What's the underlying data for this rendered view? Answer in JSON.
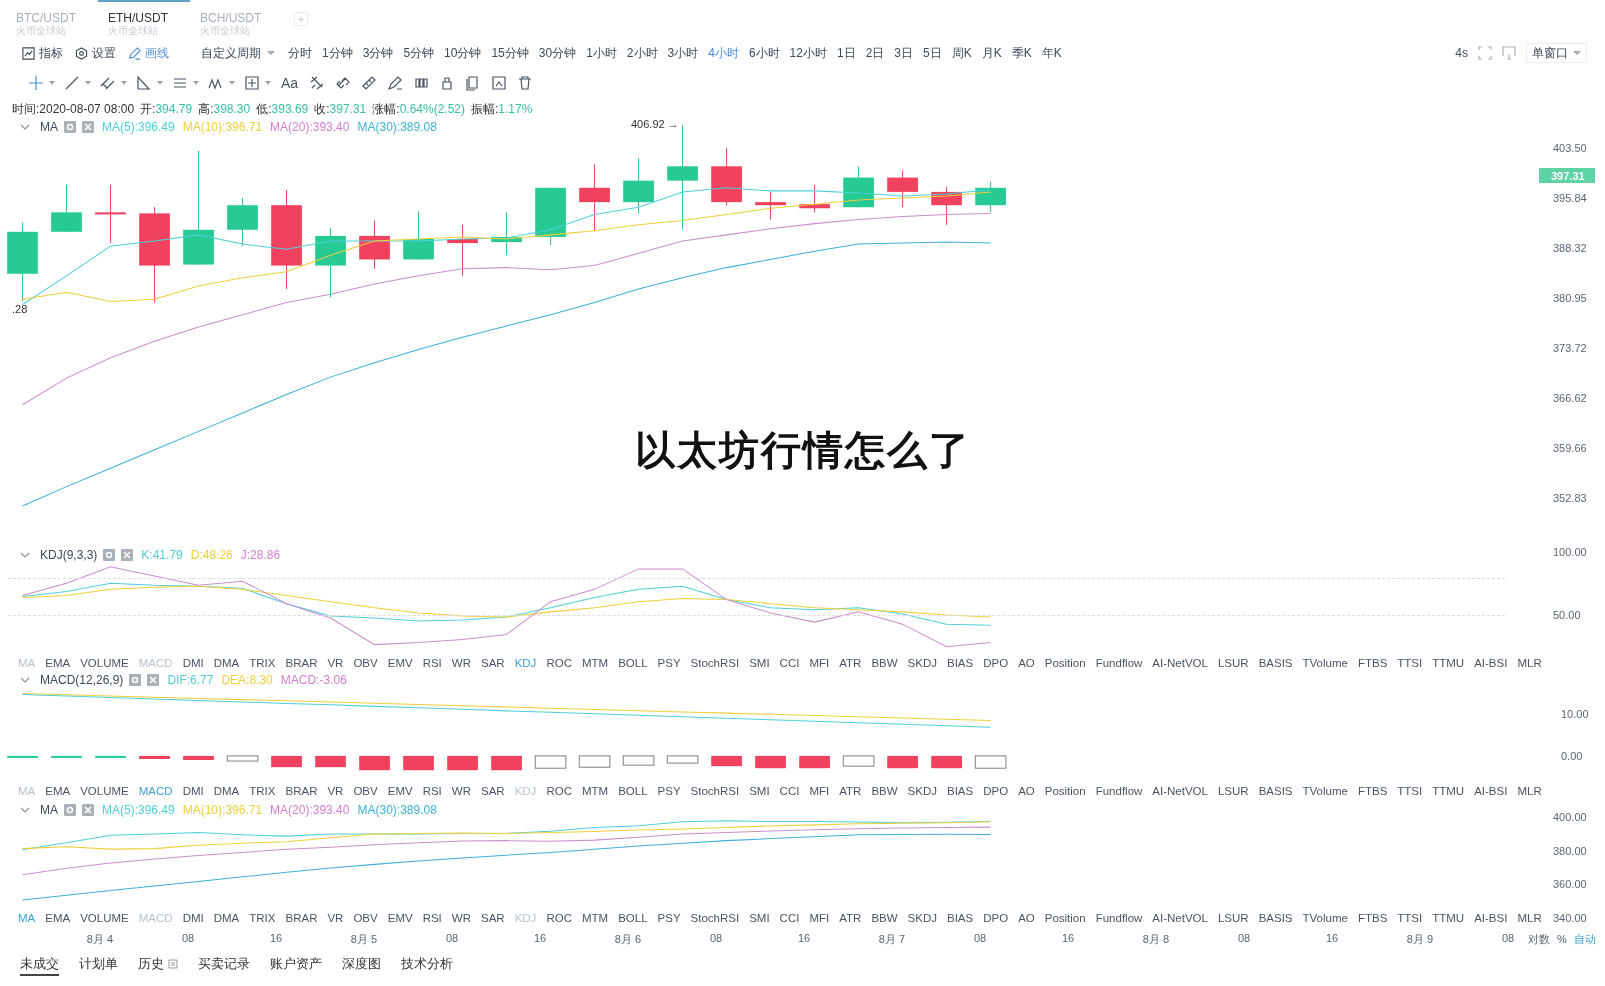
{
  "symbol_tabs": [
    {
      "pair": "BTC/USDT",
      "exchange": "火币全球站",
      "selected": false
    },
    {
      "pair": "ETH/USDT",
      "exchange": "火币全球站",
      "selected": true
    },
    {
      "pair": "BCH/USDT",
      "exchange": "火币全球站",
      "selected": false
    }
  ],
  "add_tab": "+",
  "tools": [
    {
      "label": "指标",
      "selected": false
    },
    {
      "label": "设置",
      "selected": false
    },
    {
      "label": "画线",
      "selected": true
    }
  ],
  "custom_period": "自定义周期",
  "periods": [
    {
      "label": "分时",
      "selected": false
    },
    {
      "label": "1分钟",
      "selected": false
    },
    {
      "label": "3分钟",
      "selected": false
    },
    {
      "label": "5分钟",
      "selected": false
    },
    {
      "label": "10分钟",
      "selected": false
    },
    {
      "label": "15分钟",
      "selected": false
    },
    {
      "label": "30分钟",
      "selected": false
    },
    {
      "label": "1小时",
      "selected": false
    },
    {
      "label": "2小时",
      "selected": false
    },
    {
      "label": "3小时",
      "selected": false
    },
    {
      "label": "4小时",
      "selected": true
    },
    {
      "label": "6小时",
      "selected": false
    },
    {
      "label": "12小时",
      "selected": false
    },
    {
      "label": "1日",
      "selected": false
    },
    {
      "label": "2日",
      "selected": false
    },
    {
      "label": "3日",
      "selected": false
    },
    {
      "label": "5日",
      "selected": false
    },
    {
      "label": "周K",
      "selected": false
    },
    {
      "label": "月K",
      "selected": false
    },
    {
      "label": "季K",
      "selected": false
    },
    {
      "label": "年K",
      "selected": false
    }
  ],
  "refresh": "4s",
  "window_mode": "单窗口",
  "text_tool": "Aa",
  "ohlc": [
    {
      "label": "时间:",
      "value": "2020-08-07 08:00"
    },
    {
      "label": "开:",
      "value": "394.79"
    },
    {
      "label": "高:",
      "value": "398.30"
    },
    {
      "label": "低:",
      "value": "393.69"
    },
    {
      "label": "收:",
      "value": "397.31"
    },
    {
      "label": "涨幅:",
      "value": "0.64%(2.52)"
    },
    {
      "label": "振幅:",
      "value": "1.17%"
    }
  ],
  "main_pane": {
    "name": "MA",
    "values": [
      {
        "text": "MA(5):396.49",
        "color": "#4fd0d8"
      },
      {
        "text": "MA(10):396.71",
        "color": "#efcf3a"
      },
      {
        "text": "MA(20):393.40",
        "color": "#d57fd0"
      },
      {
        "text": "MA(30):389.08",
        "color": "#3fb0d6"
      }
    ],
    "ticks": [
      "403.50",
      "395.84",
      "388.32",
      "380.95",
      "373.72",
      "366.62",
      "359.66",
      "352.83"
    ],
    "last_price": "397.31",
    "high_marker": "406.92 →",
    "low_marker": ".28",
    "caption": "以太坊行情怎么了"
  },
  "kdj_pane": {
    "name": "KDJ(9,3,3)",
    "values": [
      {
        "text": "K:41.79",
        "color": "#4fd0d8"
      },
      {
        "text": "D:48.26",
        "color": "#efcf3a"
      },
      {
        "text": "J:28.86",
        "color": "#d57fd0"
      }
    ],
    "ticks": [
      "100.00",
      "50.00"
    ]
  },
  "indicator_bars": [
    [
      {
        "label": "MA",
        "selected": false,
        "disabled": true
      },
      {
        "label": "EMA",
        "selected": false,
        "disabled": false
      },
      {
        "label": "VOLUME",
        "selected": false,
        "disabled": false
      },
      {
        "label": "MACD",
        "selected": false,
        "disabled": true
      },
      {
        "label": "DMI",
        "selected": false,
        "disabled": false
      },
      {
        "label": "DMA",
        "selected": false,
        "disabled": false
      },
      {
        "label": "TRIX",
        "selected": false,
        "disabled": false
      },
      {
        "label": "BRAR",
        "selected": false,
        "disabled": false
      },
      {
        "label": "VR",
        "selected": false,
        "disabled": false
      },
      {
        "label": "OBV",
        "selected": false,
        "disabled": false
      },
      {
        "label": "EMV",
        "selected": false,
        "disabled": false
      },
      {
        "label": "RSI",
        "selected": false,
        "disabled": false
      },
      {
        "label": "WR",
        "selected": false,
        "disabled": false
      },
      {
        "label": "SAR",
        "selected": false,
        "disabled": false
      },
      {
        "label": "KDJ",
        "selected": true,
        "disabled": false
      },
      {
        "label": "ROC",
        "selected": false,
        "disabled": false
      },
      {
        "label": "MTM",
        "selected": false,
        "disabled": false
      },
      {
        "label": "BOLL",
        "selected": false,
        "disabled": false
      },
      {
        "label": "PSY",
        "selected": false,
        "disabled": false
      },
      {
        "label": "StochRSI",
        "selected": false,
        "disabled": false
      },
      {
        "label": "SMI",
        "selected": false,
        "disabled": false
      },
      {
        "label": "CCI",
        "selected": false,
        "disabled": false
      },
      {
        "label": "MFI",
        "selected": false,
        "disabled": false
      },
      {
        "label": "ATR",
        "selected": false,
        "disabled": false
      },
      {
        "label": "BBW",
        "selected": false,
        "disabled": false
      },
      {
        "label": "SKDJ",
        "selected": false,
        "disabled": false
      },
      {
        "label": "BIAS",
        "selected": false,
        "disabled": false
      },
      {
        "label": "DPO",
        "selected": false,
        "disabled": false
      },
      {
        "label": "AO",
        "selected": false,
        "disabled": false
      },
      {
        "label": "Position",
        "selected": false,
        "disabled": false
      },
      {
        "label": "Fundflow",
        "selected": false,
        "disabled": false
      },
      {
        "label": "AI-NetVOL",
        "selected": false,
        "disabled": false
      },
      {
        "label": "LSUR",
        "selected": false,
        "disabled": false
      },
      {
        "label": "BASIS",
        "selected": false,
        "disabled": false
      },
      {
        "label": "TVolume",
        "selected": false,
        "disabled": false
      },
      {
        "label": "FTBS",
        "selected": false,
        "disabled": false
      },
      {
        "label": "TTSI",
        "selected": false,
        "disabled": false
      },
      {
        "label": "TTMU",
        "selected": false,
        "disabled": false
      },
      {
        "label": "AI-BSI",
        "selected": false,
        "disabled": false
      },
      {
        "label": "MLR",
        "selected": false,
        "disabled": false
      }
    ],
    [
      {
        "label": "MA",
        "selected": false,
        "disabled": true
      },
      {
        "label": "EMA",
        "selected": false,
        "disabled": false
      },
      {
        "label": "VOLUME",
        "selected": false,
        "disabled": false
      },
      {
        "label": "MACD",
        "selected": true,
        "disabled": false
      },
      {
        "label": "DMI",
        "selected": false,
        "disabled": false
      },
      {
        "label": "DMA",
        "selected": false,
        "disabled": false
      },
      {
        "label": "TRIX",
        "selected": false,
        "disabled": false
      },
      {
        "label": "BRAR",
        "selected": false,
        "disabled": false
      },
      {
        "label": "VR",
        "selected": false,
        "disabled": false
      },
      {
        "label": "OBV",
        "selected": false,
        "disabled": false
      },
      {
        "label": "EMV",
        "selected": false,
        "disabled": false
      },
      {
        "label": "RSI",
        "selected": false,
        "disabled": false
      },
      {
        "label": "WR",
        "selected": false,
        "disabled": false
      },
      {
        "label": "SAR",
        "selected": false,
        "disabled": false
      },
      {
        "label": "KDJ",
        "selected": false,
        "disabled": true
      },
      {
        "label": "ROC",
        "selected": false,
        "disabled": false
      },
      {
        "label": "MTM",
        "selected": false,
        "disabled": false
      },
      {
        "label": "BOLL",
        "selected": false,
        "disabled": false
      },
      {
        "label": "PSY",
        "selected": false,
        "disabled": false
      },
      {
        "label": "StochRSI",
        "selected": false,
        "disabled": false
      },
      {
        "label": "SMI",
        "selected": false,
        "disabled": false
      },
      {
        "label": "CCI",
        "selected": false,
        "disabled": false
      },
      {
        "label": "MFI",
        "selected": false,
        "disabled": false
      },
      {
        "label": "ATR",
        "selected": false,
        "disabled": false
      },
      {
        "label": "BBW",
        "selected": false,
        "disabled": false
      },
      {
        "label": "SKDJ",
        "selected": false,
        "disabled": false
      },
      {
        "label": "BIAS",
        "selected": false,
        "disabled": false
      },
      {
        "label": "DPO",
        "selected": false,
        "disabled": false
      },
      {
        "label": "AO",
        "selected": false,
        "disabled": false
      },
      {
        "label": "Position",
        "selected": false,
        "disabled": false
      },
      {
        "label": "Fundflow",
        "selected": false,
        "disabled": false
      },
      {
        "label": "AI-NetVOL",
        "selected": false,
        "disabled": false
      },
      {
        "label": "LSUR",
        "selected": false,
        "disabled": false
      },
      {
        "label": "BASIS",
        "selected": false,
        "disabled": false
      },
      {
        "label": "TVolume",
        "selected": false,
        "disabled": false
      },
      {
        "label": "FTBS",
        "selected": false,
        "disabled": false
      },
      {
        "label": "TTSI",
        "selected": false,
        "disabled": false
      },
      {
        "label": "TTMU",
        "selected": false,
        "disabled": false
      },
      {
        "label": "AI-BSI",
        "selected": false,
        "disabled": false
      },
      {
        "label": "MLR",
        "selected": false,
        "disabled": false
      }
    ],
    [
      {
        "label": "MA",
        "selected": true,
        "disabled": false
      },
      {
        "label": "EMA",
        "selected": false,
        "disabled": false
      },
      {
        "label": "VOLUME",
        "selected": false,
        "disabled": false
      },
      {
        "label": "MACD",
        "selected": false,
        "disabled": true
      },
      {
        "label": "DMI",
        "selected": false,
        "disabled": false
      },
      {
        "label": "DMA",
        "selected": false,
        "disabled": false
      },
      {
        "label": "TRIX",
        "selected": false,
        "disabled": false
      },
      {
        "label": "BRAR",
        "selected": false,
        "disabled": false
      },
      {
        "label": "VR",
        "selected": false,
        "disabled": false
      },
      {
        "label": "OBV",
        "selected": false,
        "disabled": false
      },
      {
        "label": "EMV",
        "selected": false,
        "disabled": false
      },
      {
        "label": "RSI",
        "selected": false,
        "disabled": false
      },
      {
        "label": "WR",
        "selected": false,
        "disabled": false
      },
      {
        "label": "SAR",
        "selected": false,
        "disabled": false
      },
      {
        "label": "KDJ",
        "selected": false,
        "disabled": true
      },
      {
        "label": "ROC",
        "selected": false,
        "disabled": false
      },
      {
        "label": "MTM",
        "selected": false,
        "disabled": false
      },
      {
        "label": "BOLL",
        "selected": false,
        "disabled": false
      },
      {
        "label": "PSY",
        "selected": false,
        "disabled": false
      },
      {
        "label": "StochRSI",
        "selected": false,
        "disabled": false
      },
      {
        "label": "SMI",
        "selected": false,
        "disabled": false
      },
      {
        "label": "CCI",
        "selected": false,
        "disabled": false
      },
      {
        "label": "MFI",
        "selected": false,
        "disabled": false
      },
      {
        "label": "ATR",
        "selected": false,
        "disabled": false
      },
      {
        "label": "BBW",
        "selected": false,
        "disabled": false
      },
      {
        "label": "SKDJ",
        "selected": false,
        "disabled": false
      },
      {
        "label": "BIAS",
        "selected": false,
        "disabled": false
      },
      {
        "label": "DPO",
        "selected": false,
        "disabled": false
      },
      {
        "label": "AO",
        "selected": false,
        "disabled": false
      },
      {
        "label": "Position",
        "selected": false,
        "disabled": false
      },
      {
        "label": "Fundflow",
        "selected": false,
        "disabled": false
      },
      {
        "label": "AI-NetVOL",
        "selected": false,
        "disabled": false
      },
      {
        "label": "LSUR",
        "selected": false,
        "disabled": false
      },
      {
        "label": "BASIS",
        "selected": false,
        "disabled": false
      },
      {
        "label": "TVolume",
        "selected": false,
        "disabled": false
      },
      {
        "label": "FTBS",
        "selected": false,
        "disabled": false
      },
      {
        "label": "TTSI",
        "selected": false,
        "disabled": false
      },
      {
        "label": "TTMU",
        "selected": false,
        "disabled": false
      },
      {
        "label": "AI-BSI",
        "selected": false,
        "disabled": false
      },
      {
        "label": "MLR",
        "selected": false,
        "disabled": false
      }
    ]
  ],
  "macd_pane": {
    "name": "MACD(12,26,9)",
    "values": [
      {
        "text": "DIF:6.77",
        "color": "#4fd0d8"
      },
      {
        "text": "DEA:8.30",
        "color": "#efcf3a"
      },
      {
        "text": "MACD:-3.06",
        "color": "#d57fd0"
      }
    ],
    "ticks": [
      "10.00",
      "0.00"
    ]
  },
  "ma_pane": {
    "name": "MA",
    "values": [
      {
        "text": "MA(5):396.49",
        "color": "#4fd0d8"
      },
      {
        "text": "MA(10):396.71",
        "color": "#efcf3a"
      },
      {
        "text": "MA(20):393.40",
        "color": "#d57fd0"
      },
      {
        "text": "MA(30):389.08",
        "color": "#3fb0d6"
      }
    ],
    "ticks": [
      "400.00",
      "380.00",
      "360.00",
      "340.00"
    ]
  },
  "time_axis": [
    "8月 4",
    "08",
    "16",
    "8月 5",
    "08",
    "16",
    "8月 6",
    "08",
    "16",
    "8月 7",
    "08",
    "16",
    "8月 8",
    "08",
    "16",
    "8月 9",
    "08"
  ],
  "scale_options": [
    {
      "label": "对数",
      "selected": false
    },
    {
      "label": "%",
      "selected": false
    },
    {
      "label": "自动",
      "selected": true
    }
  ],
  "bottom_tabs": [
    {
      "label": "未成交",
      "selected": true
    },
    {
      "label": "计划单",
      "selected": false
    },
    {
      "label": "历史",
      "selected": false
    },
    {
      "label": "买卖记录",
      "selected": false
    },
    {
      "label": "账户资产",
      "selected": false
    },
    {
      "label": "深度图",
      "selected": false
    },
    {
      "label": "技术分析",
      "selected": false
    }
  ]
}
